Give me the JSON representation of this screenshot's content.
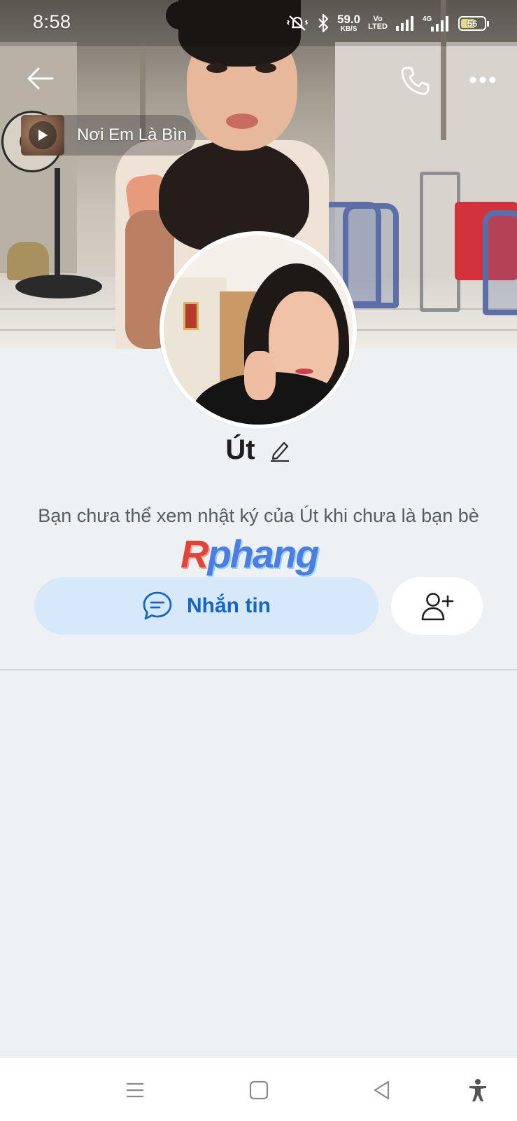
{
  "status_bar": {
    "time": "8:58",
    "net_speed_value": "59.0",
    "net_speed_unit": "KB/S",
    "volte_top": "Vo",
    "volte_bottom": "LTED",
    "network_type": "4G",
    "battery_level": "56",
    "icons": [
      "mute-vibrate-icon",
      "bluetooth-icon",
      "signal-icon",
      "signal-4g-icon",
      "battery-icon"
    ]
  },
  "header": {
    "back_icon": "arrow-left-icon",
    "call_icon": "phone-icon",
    "more_icon": "more-dots-icon"
  },
  "music": {
    "title": "Nơi Em Là Bìn",
    "icon": "play-icon"
  },
  "profile": {
    "name": "Út",
    "edit_icon": "pencil-icon",
    "privacy_note": "Bạn chưa thể xem nhật ký của Út khi chưa là bạn bè"
  },
  "watermark": {
    "first_letter": "R",
    "rest": "phang"
  },
  "actions": {
    "message_label": "Nhắn tin",
    "message_icon": "chat-bubble-icon",
    "add_friend_icon": "add-user-icon"
  },
  "nav_bar": {
    "items": [
      "menu-icon",
      "home-square-icon",
      "back-triangle-icon",
      "accessibility-icon"
    ]
  },
  "colors": {
    "page_background": "#eef1f4",
    "message_button_bg": "#d7e8fb",
    "accent_blue": "#1565c8",
    "text_gray": "#555b61"
  }
}
